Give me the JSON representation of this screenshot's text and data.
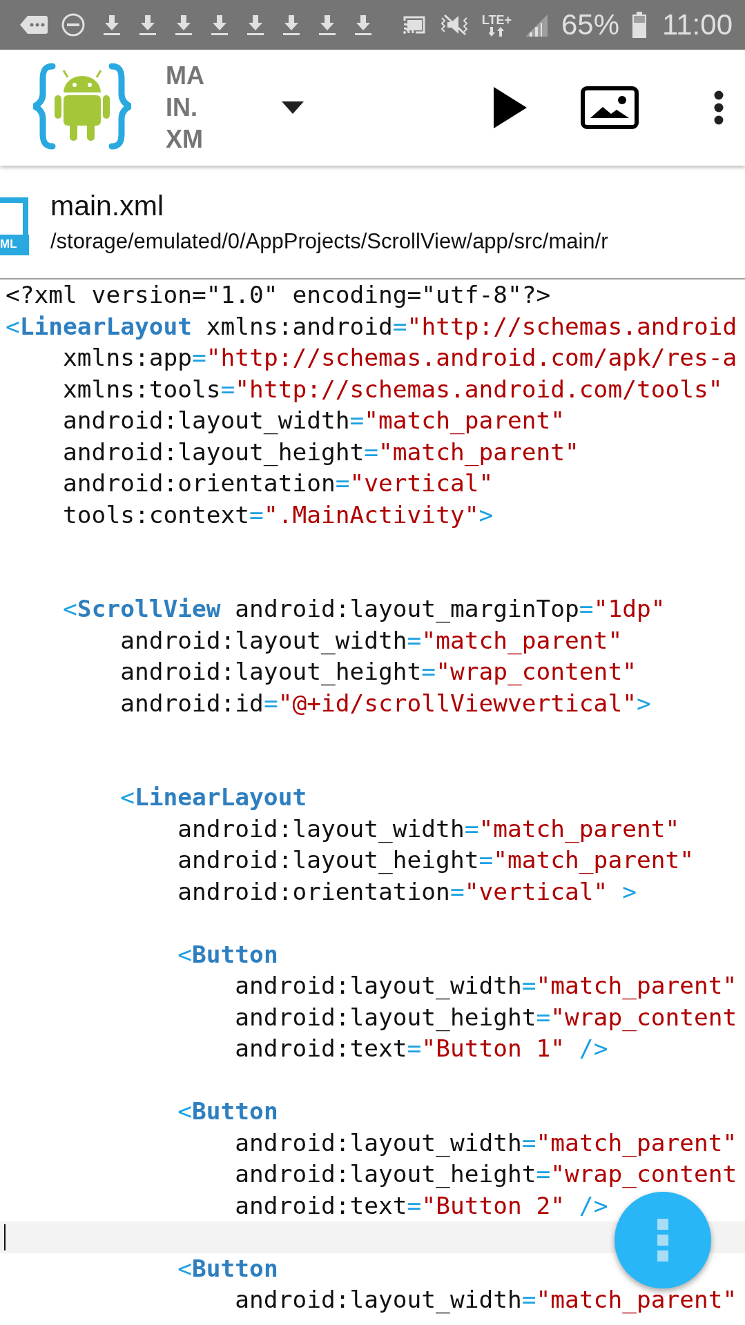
{
  "status_bar": {
    "network": "LTE+",
    "battery": "65%",
    "time": "11:00"
  },
  "toolbar": {
    "title": "MAIN.XM"
  },
  "file": {
    "name": "main.xml",
    "badge": "ML",
    "path": "/storage/emulated/0/AppProjects/ScrollView/app/src/main/r"
  },
  "editor": {
    "lines": [
      {
        "current": false,
        "tokens": [
          {
            "kind": "attr",
            "text": "<?xml version=\"1.0\" encoding=\"utf-8\"?>"
          }
        ]
      },
      {
        "current": false,
        "tokens": [
          {
            "kind": "punct",
            "text": "<"
          },
          {
            "kind": "tag",
            "text": "LinearLayout"
          },
          {
            "kind": "attr",
            "text": " xmlns:android"
          },
          {
            "kind": "punct",
            "text": "="
          },
          {
            "kind": "value",
            "text": "\"http://schemas.android"
          }
        ]
      },
      {
        "current": false,
        "tokens": [
          {
            "kind": "attr",
            "text": "    xmlns:app"
          },
          {
            "kind": "punct",
            "text": "="
          },
          {
            "kind": "value",
            "text": "\"http://schemas.android.com/apk/res-a"
          }
        ]
      },
      {
        "current": false,
        "tokens": [
          {
            "kind": "attr",
            "text": "    xmlns:tools"
          },
          {
            "kind": "punct",
            "text": "="
          },
          {
            "kind": "value",
            "text": "\"http://schemas.android.com/tools\""
          }
        ]
      },
      {
        "current": false,
        "tokens": [
          {
            "kind": "attr",
            "text": "    android:layout_width"
          },
          {
            "kind": "punct",
            "text": "="
          },
          {
            "kind": "value",
            "text": "\"match_parent\""
          }
        ]
      },
      {
        "current": false,
        "tokens": [
          {
            "kind": "attr",
            "text": "    android:layout_height"
          },
          {
            "kind": "punct",
            "text": "="
          },
          {
            "kind": "value",
            "text": "\"match_parent\""
          }
        ]
      },
      {
        "current": false,
        "tokens": [
          {
            "kind": "attr",
            "text": "    android:orientation"
          },
          {
            "kind": "punct",
            "text": "="
          },
          {
            "kind": "value",
            "text": "\"vertical\""
          }
        ]
      },
      {
        "current": false,
        "tokens": [
          {
            "kind": "attr",
            "text": "    tools:context"
          },
          {
            "kind": "punct",
            "text": "="
          },
          {
            "kind": "value",
            "text": "\".MainActivity\""
          },
          {
            "kind": "punct",
            "text": ">"
          }
        ]
      },
      {
        "current": false
      },
      {
        "current": false
      },
      {
        "current": false,
        "tokens": [
          {
            "kind": "punct",
            "text": "    <"
          },
          {
            "kind": "tag",
            "text": "ScrollView"
          },
          {
            "kind": "attr",
            "text": " android:layout_marginTop"
          },
          {
            "kind": "punct",
            "text": "="
          },
          {
            "kind": "value",
            "text": "\"1dp\""
          }
        ]
      },
      {
        "current": false,
        "tokens": [
          {
            "kind": "attr",
            "text": "        android:layout_width"
          },
          {
            "kind": "punct",
            "text": "="
          },
          {
            "kind": "value",
            "text": "\"match_parent\""
          }
        ]
      },
      {
        "current": false,
        "tokens": [
          {
            "kind": "attr",
            "text": "        android:layout_height"
          },
          {
            "kind": "punct",
            "text": "="
          },
          {
            "kind": "value",
            "text": "\"wrap_content\""
          }
        ]
      },
      {
        "current": false,
        "tokens": [
          {
            "kind": "attr",
            "text": "        android:id"
          },
          {
            "kind": "punct",
            "text": "="
          },
          {
            "kind": "value",
            "text": "\"@+id/scrollViewvertical\""
          },
          {
            "kind": "punct",
            "text": ">"
          }
        ]
      },
      {
        "current": false
      },
      {
        "current": false
      },
      {
        "current": false,
        "tokens": [
          {
            "kind": "punct",
            "text": "        <"
          },
          {
            "kind": "tag",
            "text": "LinearLayout"
          }
        ]
      },
      {
        "current": false,
        "tokens": [
          {
            "kind": "attr",
            "text": "            android:layout_width"
          },
          {
            "kind": "punct",
            "text": "="
          },
          {
            "kind": "value",
            "text": "\"match_parent\""
          }
        ]
      },
      {
        "current": false,
        "tokens": [
          {
            "kind": "attr",
            "text": "            android:layout_height"
          },
          {
            "kind": "punct",
            "text": "="
          },
          {
            "kind": "value",
            "text": "\"match_parent\""
          }
        ]
      },
      {
        "current": false,
        "tokens": [
          {
            "kind": "attr",
            "text": "            android:orientation"
          },
          {
            "kind": "punct",
            "text": "="
          },
          {
            "kind": "value",
            "text": "\"vertical\""
          },
          {
            "kind": "punct",
            "text": " >"
          }
        ]
      },
      {
        "current": false
      },
      {
        "current": false,
        "tokens": [
          {
            "kind": "punct",
            "text": "            <"
          },
          {
            "kind": "tag",
            "text": "Button"
          }
        ]
      },
      {
        "current": false,
        "tokens": [
          {
            "kind": "attr",
            "text": "                android:layout_width"
          },
          {
            "kind": "punct",
            "text": "="
          },
          {
            "kind": "value",
            "text": "\"match_parent\""
          }
        ]
      },
      {
        "current": false,
        "tokens": [
          {
            "kind": "attr",
            "text": "                android:layout_height"
          },
          {
            "kind": "punct",
            "text": "="
          },
          {
            "kind": "value",
            "text": "\"wrap_content"
          }
        ]
      },
      {
        "current": false,
        "tokens": [
          {
            "kind": "attr",
            "text": "                android:text"
          },
          {
            "kind": "punct",
            "text": "="
          },
          {
            "kind": "value",
            "text": "\"Button 1\""
          },
          {
            "kind": "punct",
            "text": " />"
          }
        ]
      },
      {
        "current": false
      },
      {
        "current": false,
        "tokens": [
          {
            "kind": "punct",
            "text": "            <"
          },
          {
            "kind": "tag",
            "text": "Button"
          }
        ]
      },
      {
        "current": false,
        "tokens": [
          {
            "kind": "attr",
            "text": "                android:layout_width"
          },
          {
            "kind": "punct",
            "text": "="
          },
          {
            "kind": "value",
            "text": "\"match_parent\""
          }
        ]
      },
      {
        "current": false,
        "tokens": [
          {
            "kind": "attr",
            "text": "                android:layout_height"
          },
          {
            "kind": "punct",
            "text": "="
          },
          {
            "kind": "value",
            "text": "\"wrap_content"
          }
        ]
      },
      {
        "current": false,
        "tokens": [
          {
            "kind": "attr",
            "text": "                android:text"
          },
          {
            "kind": "punct",
            "text": "="
          },
          {
            "kind": "value",
            "text": "\"Button 2\""
          },
          {
            "kind": "punct",
            "text": " />"
          }
        ]
      },
      {
        "current": true
      },
      {
        "current": false,
        "tokens": [
          {
            "kind": "punct",
            "text": "            <"
          },
          {
            "kind": "tag",
            "text": "Button"
          }
        ]
      },
      {
        "current": false,
        "tokens": [
          {
            "kind": "attr",
            "text": "                android:layout_width"
          },
          {
            "kind": "punct",
            "text": "="
          },
          {
            "kind": "value",
            "text": "\"match_parent\""
          }
        ]
      }
    ]
  }
}
